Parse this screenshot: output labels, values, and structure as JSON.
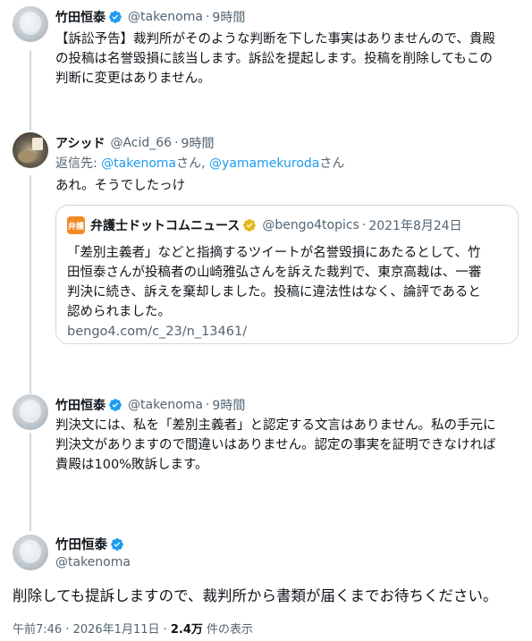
{
  "tweets": {
    "t1": {
      "name": "竹田恒泰",
      "handle": "@takenoma",
      "dot": "·",
      "time": "9時間",
      "text_line1": "【訴訟予告】裁判所がそのような判断を下した事実はありませんので、貴殿",
      "text_line2": "の投稿は名誉毀損に該当します。訴訟を提起します。投稿を削除してもこの",
      "text_line3": "判断に変更はありません。"
    },
    "t2": {
      "name": "アシッド",
      "handle": "@Acid_66",
      "dot": "·",
      "time": "9時間",
      "reply_prefix": "返信先: ",
      "reply_user1": "@takenoma",
      "reply_san1": "さん, ",
      "reply_user2": "@yamamekuroda",
      "reply_san2": "さん",
      "text": "あれ。そうでしたっけ"
    },
    "quote": {
      "logo_text": "弁護",
      "name": "弁護士ドットコムニュース",
      "handle": "@bengo4topics",
      "dot": "·",
      "date": "2021年8月24日",
      "line1": "「差別主義者」などと指摘するツイートが名誉毀損にあたるとして、竹",
      "line2": "田恒泰さんが投稿者の山崎雅弘さんを訴えた裁判で、東京高裁は、一審",
      "line3": "判決に続き、訴えを棄却しました。投稿に違法性はなく、論評であると",
      "line4": "認められました。",
      "url": "bengo4.com/c_23/n_13461/"
    },
    "t3": {
      "name": "竹田恒泰",
      "handle": "@takenoma",
      "dot": "·",
      "time": "9時間",
      "text_line1": "判決文には、私を「差別主義者」と認定する文言はありません。私の手元に",
      "text_line2": "判決文がありますので間違いはありません。認定の事実を証明できなければ",
      "text_line3": "貴殿は100%敗訴します。"
    },
    "main": {
      "name": "竹田恒泰",
      "handle": "@takenoma",
      "text": "削除しても提訴しますので、裁判所から書類が届くまでお待ちください。",
      "timestamp": "午前7:46 · 2026年1月11日 · ",
      "views_count": "2.4万",
      "views_label": " 件の表示"
    }
  },
  "colors": {
    "accent": "#1d9bf0",
    "muted": "#536471",
    "border": "#cfd9de",
    "verified_blue": "#1d9bf0",
    "verified_gold": "#e2b719"
  }
}
